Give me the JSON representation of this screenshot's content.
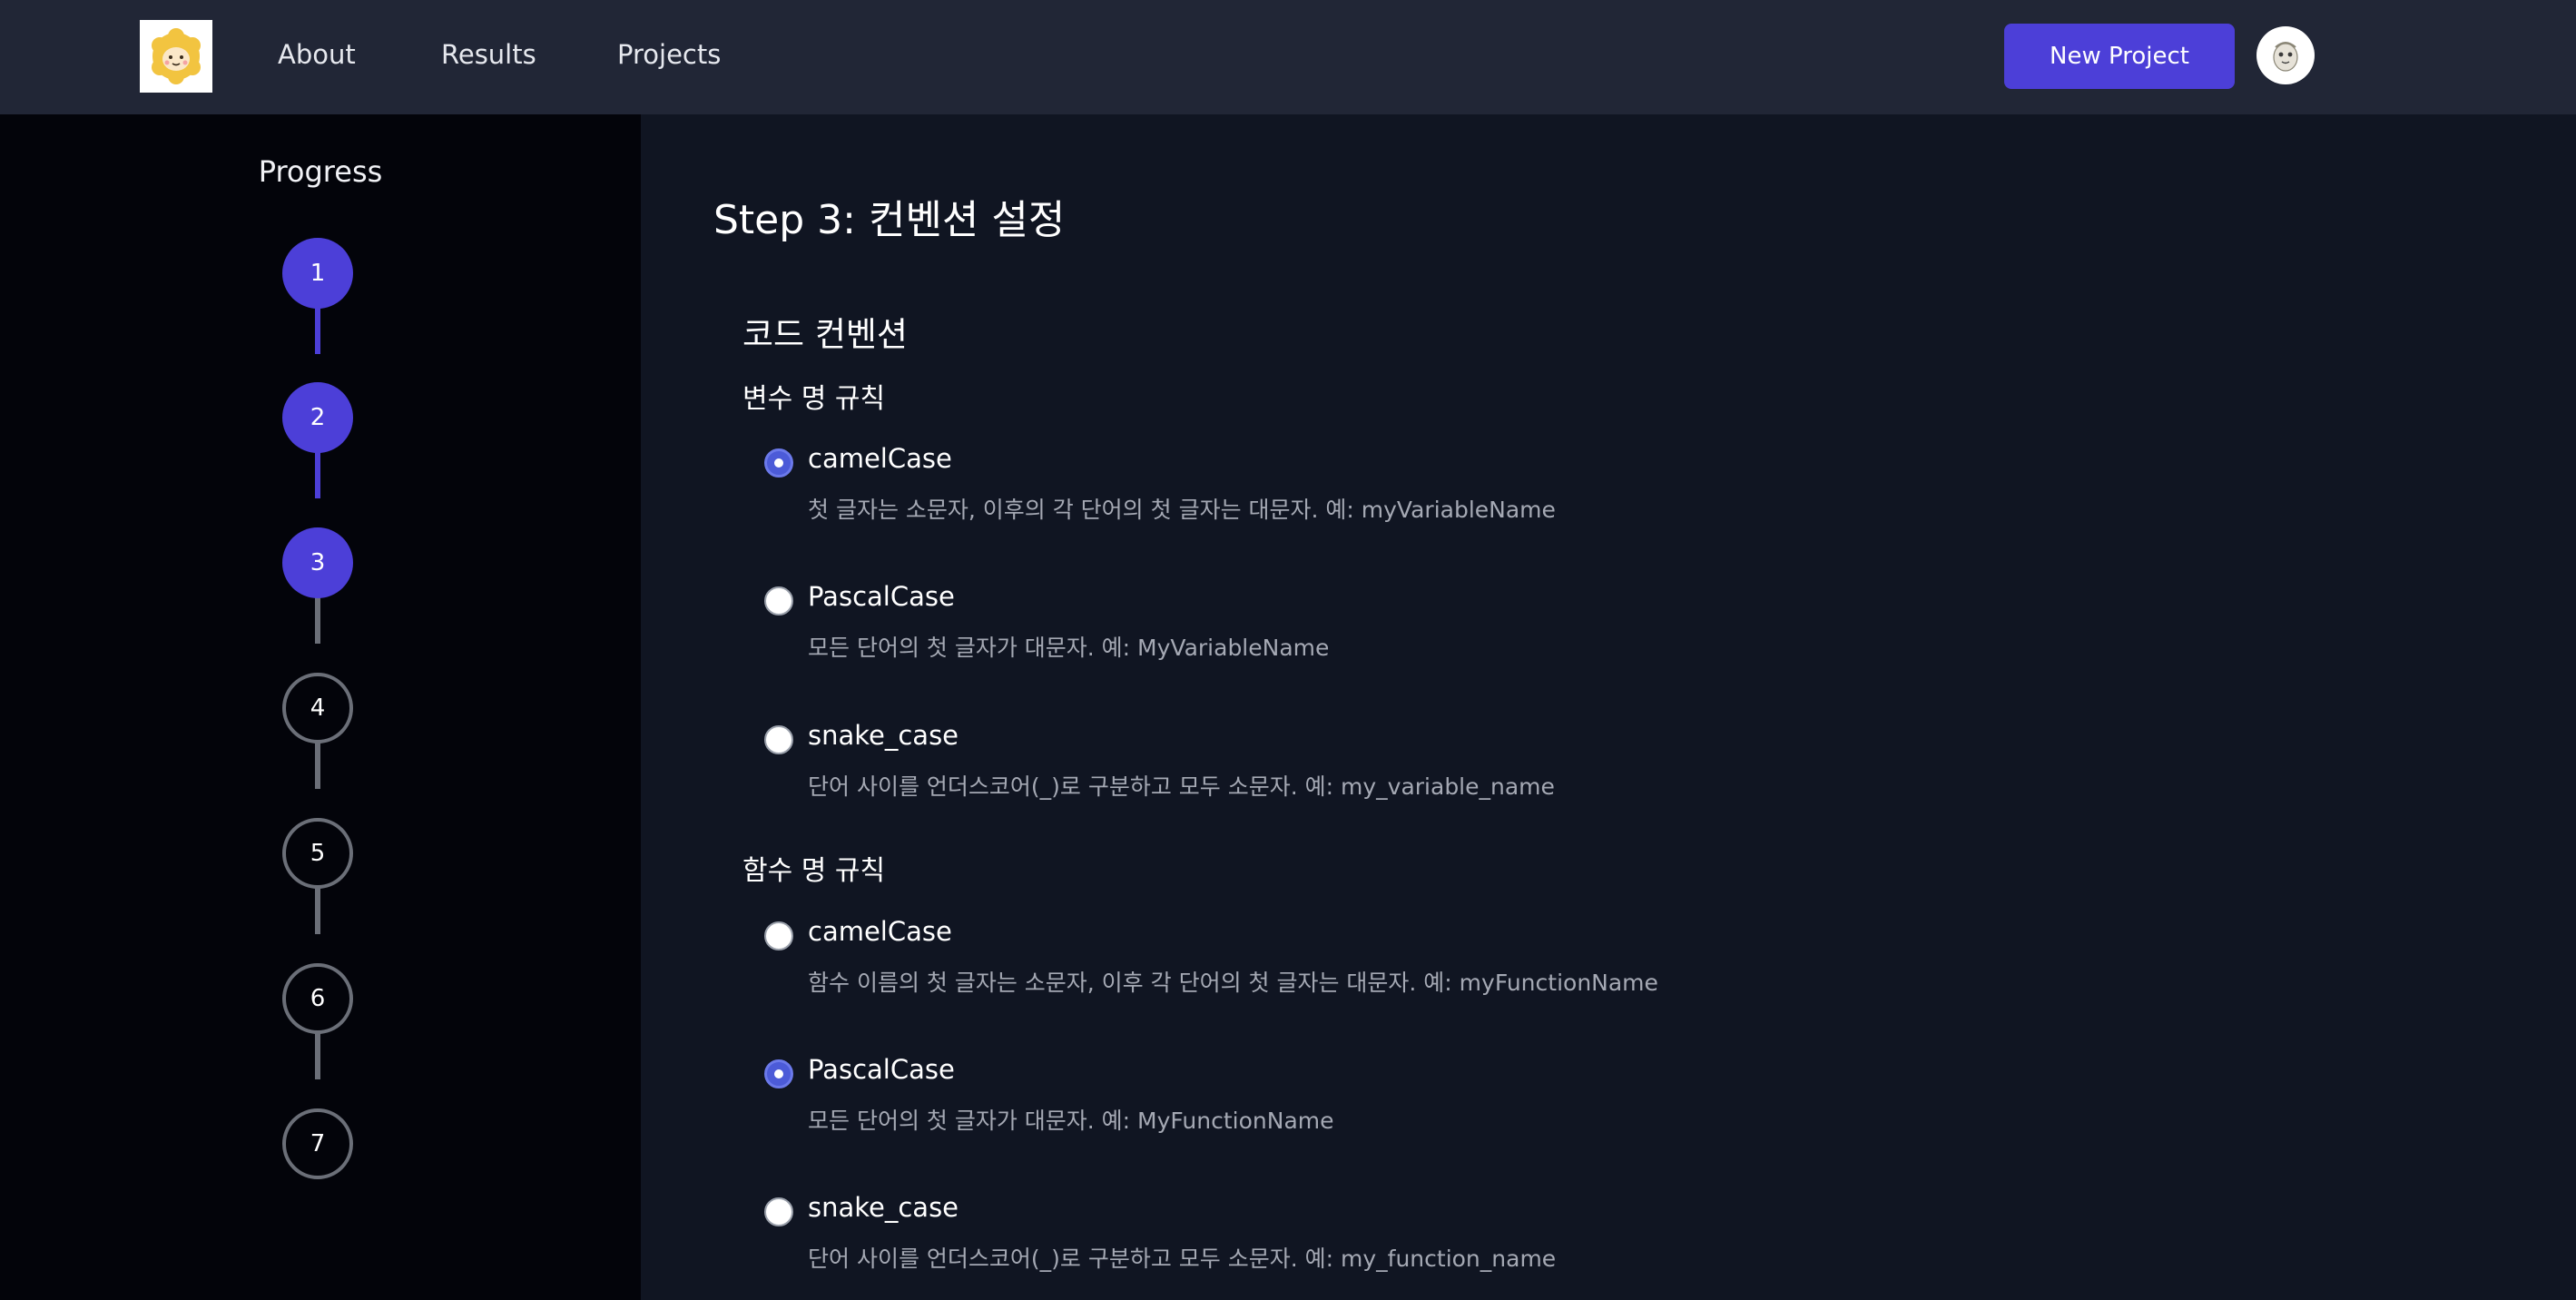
{
  "header": {
    "logo_icon": "sheep-logo-icon",
    "nav": [
      "About",
      "Results",
      "Projects"
    ],
    "new_project_label": "New Project",
    "avatar_icon": "avatar-icon"
  },
  "sidebar": {
    "title": "Progress",
    "steps": [
      {
        "number": "1",
        "state": "complete"
      },
      {
        "number": "2",
        "state": "complete"
      },
      {
        "number": "3",
        "state": "current"
      },
      {
        "number": "4",
        "state": "pending"
      },
      {
        "number": "5",
        "state": "pending"
      },
      {
        "number": "6",
        "state": "pending"
      },
      {
        "number": "7",
        "state": "pending"
      }
    ]
  },
  "main": {
    "title": "Step 3: 컨벤션 설정",
    "section_title": "코드 컨벤션",
    "groups": [
      {
        "title": "변수 명 규칙",
        "selected": "camelCase",
        "options": [
          {
            "label": "camelCase",
            "description": "첫 글자는 소문자, 이후의 각 단어의 첫 글자는 대문자. 예: myVariableName"
          },
          {
            "label": "PascalCase",
            "description": "모든 단어의 첫 글자가 대문자. 예: MyVariableName"
          },
          {
            "label": "snake_case",
            "description": "단어 사이를 언더스코어(_)로 구분하고 모두 소문자. 예: my_variable_name"
          }
        ]
      },
      {
        "title": "함수 명 규칙",
        "selected": "PascalCase",
        "options": [
          {
            "label": "camelCase",
            "description": "함수 이름의 첫 글자는 소문자, 이후 각 단어의 첫 글자는 대문자. 예: myFunctionName"
          },
          {
            "label": "PascalCase",
            "description": "모든 단어의 첫 글자가 대문자. 예: MyFunctionName"
          },
          {
            "label": "snake_case",
            "description": "단어 사이를 언더스코어(_)로 구분하고 모두 소문자. 예: my_function_name"
          }
        ]
      }
    ]
  },
  "colors": {
    "accent": "#4c3fd8",
    "radio_selected": "#4c5bd8",
    "header_bg": "#212636",
    "sidebar_bg": "#03040a",
    "main_bg": "#101522",
    "muted_text": "#a5a9b4",
    "step_pending_border": "#6b6f78"
  }
}
